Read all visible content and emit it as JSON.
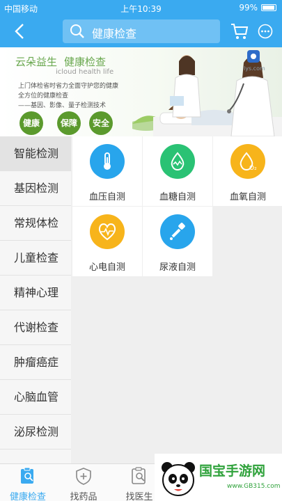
{
  "status_bar": {
    "carrier": "中国移动",
    "time": "上午10:39",
    "battery": "99%"
  },
  "nav": {
    "search_placeholder": "健康检查"
  },
  "banner": {
    "brand_1": "云朵益生",
    "brand_2": "健康检查",
    "brand_en": "icloud health life",
    "lines": [
      "上门体检省时省力全面守护您的健康",
      "全方位的健康检查",
      "——基因、影像、量子检测技术"
    ],
    "badges": [
      "健康",
      "保障",
      "安全"
    ],
    "site_tail": "lys.com"
  },
  "categories": [
    {
      "label": "智能检测",
      "active": true
    },
    {
      "label": "基因检测"
    },
    {
      "label": "常规体检"
    },
    {
      "label": "儿童检查"
    },
    {
      "label": "精神心理"
    },
    {
      "label": "代谢检查"
    },
    {
      "label": "肿瘤癌症"
    },
    {
      "label": "心脑血管"
    },
    {
      "label": "泌尿检测"
    }
  ],
  "tools": [
    {
      "label": "血压自测",
      "icon": "thermometer-icon",
      "color": "#28a5ec"
    },
    {
      "label": "血糖自测",
      "icon": "blood-drop-icon",
      "color": "#2ac274"
    },
    {
      "label": "血氧自测",
      "icon": "oxygen-icon",
      "color": "#f7b41b"
    },
    {
      "label": "心电自测",
      "icon": "heart-pulse-icon",
      "color": "#f7b41b"
    },
    {
      "label": "尿液自测",
      "icon": "dropper-icon",
      "color": "#28a5ec"
    }
  ],
  "tabs": [
    {
      "label": "健康检查",
      "active": true
    },
    {
      "label": "找药品"
    },
    {
      "label": "找医生"
    }
  ],
  "watermark": {
    "title": "国宝手游网",
    "url": "www.GB315.com"
  },
  "colors": {
    "primary": "#3aaaf0",
    "active_tab": "#3aaaf0"
  }
}
